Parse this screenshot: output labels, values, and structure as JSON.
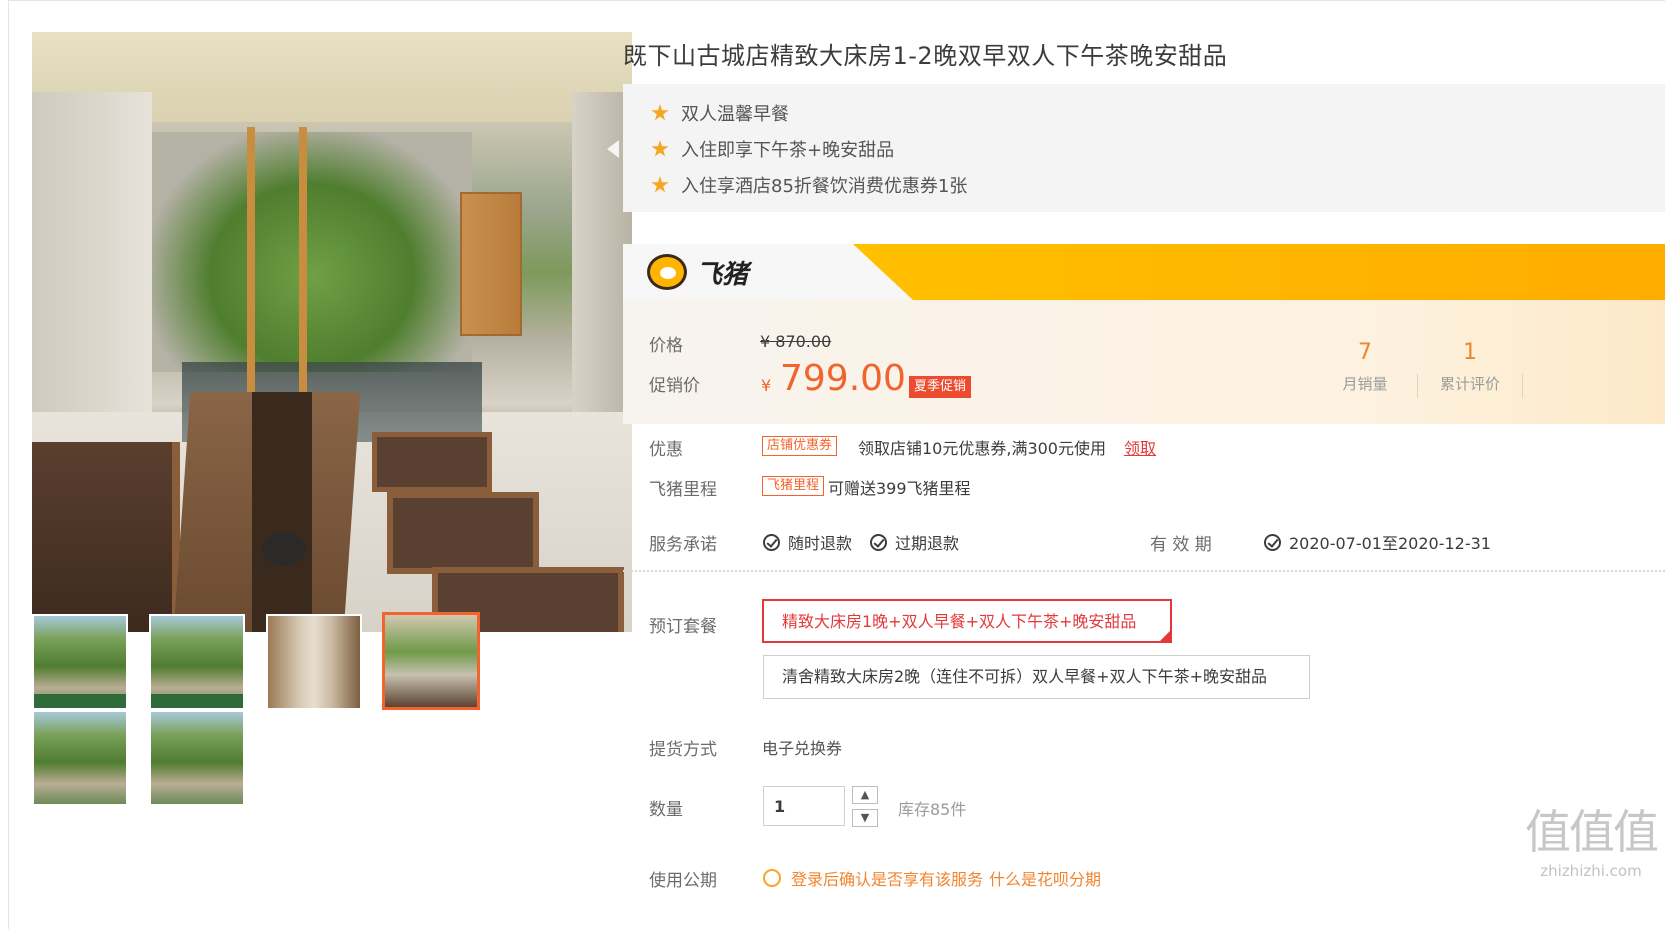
{
  "title": "既下山古城店精致大床房1-2晚双早双人下午茶晚安甜品",
  "features": [
    "双人温馨早餐",
    "入住即享下午茶+晚安甜品",
    "入住享酒店85折餐饮消费优惠券1张"
  ],
  "brand": {
    "name": "飞猪",
    "accent": "#ffb400"
  },
  "price": {
    "label": "价格",
    "original": "¥ 870.00",
    "promo_label": "促销价",
    "currency": "¥",
    "promo": "799.00",
    "tag": "夏季促销"
  },
  "stats": [
    {
      "value": "7",
      "caption": "月销量"
    },
    {
      "value": "1",
      "caption": "累计评价"
    }
  ],
  "coupon": {
    "label": "优惠",
    "tag": "店铺优惠券",
    "text": "领取店铺10元优惠券,满300元使用",
    "link": "领取"
  },
  "miles": {
    "label": "飞猪里程",
    "tag": "飞猪里程",
    "text": "可赠送399飞猪里程"
  },
  "service": {
    "label": "服务承诺",
    "items": [
      "随时退款",
      "过期退款"
    ],
    "validity_label": "有 效 期",
    "validity": "2020-07-01至2020-12-31"
  },
  "packages": {
    "label": "预订套餐",
    "options": [
      "精致大床房1晚+双人早餐+双人下午茶+晚安甜品",
      "清舍精致大床房2晚（连住不可拆）双人早餐+双人下午茶+晚安甜品"
    ],
    "selected_index": 0
  },
  "delivery": {
    "label": "提货方式",
    "value": "电子兑换券"
  },
  "quantity": {
    "label": "数量",
    "value": "1",
    "stock": "库存85件"
  },
  "usage": {
    "label": "使用公期",
    "warn": "登录后确认是否享有该服务",
    "link": "什么是花呗分期"
  },
  "watermark": {
    "main": "值值值",
    "site": "zhizhizhi.com"
  },
  "colors": {
    "price": "#f1642d",
    "tag_red": "#ec4b2f",
    "link": "#e4393c",
    "stat": "#f1842d"
  }
}
